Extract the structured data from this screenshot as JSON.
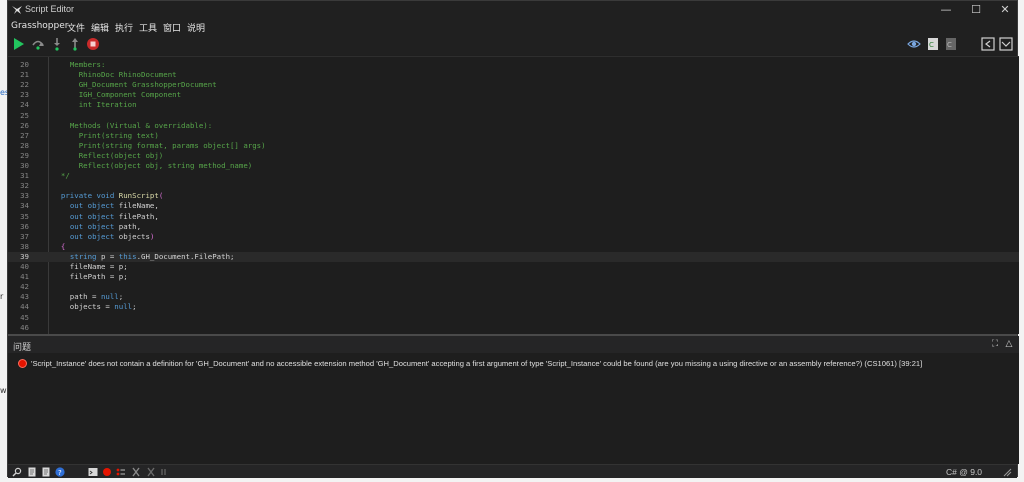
{
  "window": {
    "title": "Script Editor"
  },
  "menu": [
    "Grasshopper",
    "文件",
    "编辑",
    "执行",
    "工具",
    "窗口",
    "说明"
  ],
  "editor": {
    "lines": [
      {
        "n": "20",
        "html": "    <span class='c'>Members:</span>"
      },
      {
        "n": "21",
        "html": "      <span class='c'>RhinoDoc RhinoDocument</span>"
      },
      {
        "n": "22",
        "html": "      <span class='c'>GH_Document GrasshopperDocument</span>"
      },
      {
        "n": "23",
        "html": "      <span class='c'>IGH_Component Component</span>"
      },
      {
        "n": "24",
        "html": "      <span class='c'>int Iteration</span>"
      },
      {
        "n": "25",
        "html": ""
      },
      {
        "n": "26",
        "html": "    <span class='c'>Methods (Virtual &amp; overridable):</span>"
      },
      {
        "n": "27",
        "html": "      <span class='c'>Print(string text)</span>"
      },
      {
        "n": "28",
        "html": "      <span class='c'>Print(string format, params object[] args)</span>"
      },
      {
        "n": "29",
        "html": "      <span class='c'>Reflect(object obj)</span>"
      },
      {
        "n": "30",
        "html": "      <span class='c'>Reflect(object obj, string method_name)</span>"
      },
      {
        "n": "31",
        "html": "  <span class='c'>*/</span>"
      },
      {
        "n": "32",
        "html": ""
      },
      {
        "n": "33",
        "html": "  <span class='k'>private</span> <span class='k'>void</span> <span class='y'>RunScript</span><span class='p'>(</span>"
      },
      {
        "n": "34",
        "html": "    <span class='k'>out</span> <span class='k'>object</span> fileName,"
      },
      {
        "n": "35",
        "html": "    <span class='k'>out</span> <span class='k'>object</span> filePath,"
      },
      {
        "n": "36",
        "html": "    <span class='k'>out</span> <span class='k'>object</span> path,"
      },
      {
        "n": "37",
        "html": "    <span class='k'>out</span> <span class='k'>object</span> objects<span class='p'>)</span>"
      },
      {
        "n": "38",
        "html": "  <span class='p'>{</span>"
      },
      {
        "n": "39",
        "html": "    <span class='k'>string</span> p = <span class='k'>this</span>.GH_Document.FilePath;",
        "current": true
      },
      {
        "n": "40",
        "html": "    fileName = p;"
      },
      {
        "n": "41",
        "html": "    filePath = p;"
      },
      {
        "n": "42",
        "html": ""
      },
      {
        "n": "43",
        "html": "    path = <span class='k'>null</span>;"
      },
      {
        "n": "44",
        "html": "    objects = <span class='k'>null</span>;"
      },
      {
        "n": "45",
        "html": ""
      },
      {
        "n": "46",
        "html": ""
      }
    ]
  },
  "problems": {
    "title": "问题",
    "error": "'Script_Instance' does not contain a definition for 'GH_Document' and no accessible extension method 'GH_Document' accepting a first argument of type 'Script_Instance' could be found (are you missing a using directive or an assembly reference?) (CS1061) [39:21]"
  },
  "status": {
    "language": "C# @ 9.0"
  },
  "colors": {
    "background": "#1e1e1e",
    "error": "#e51400",
    "keyword": "#569cd6",
    "comment": "#57a64a"
  },
  "desktop": {
    "left_glyphs": [
      "es",
      "r",
      "w"
    ]
  }
}
